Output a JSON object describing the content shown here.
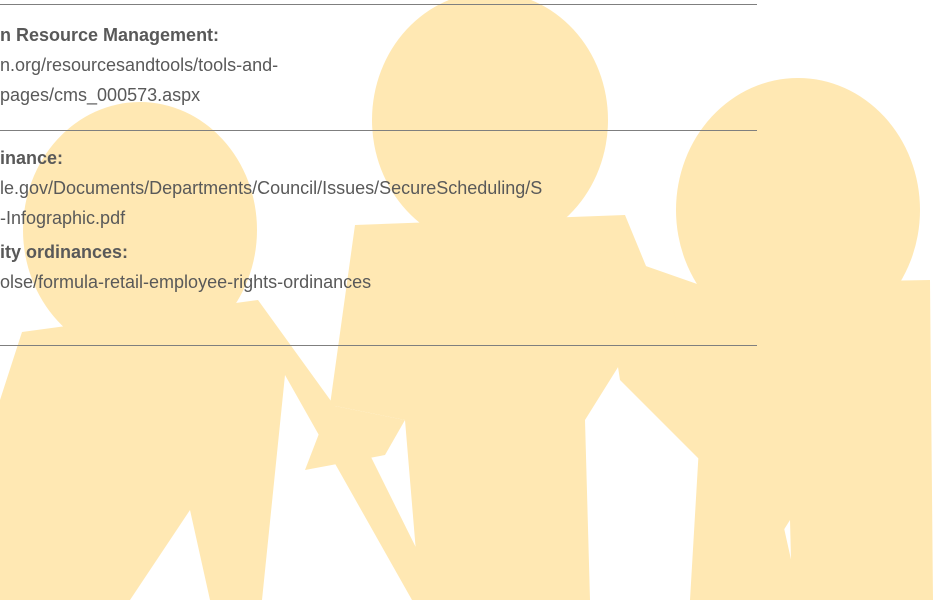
{
  "background": {
    "figure_color": "#FFE8B3",
    "figure_icon": "paper-doll-people-chain"
  },
  "entries": [
    {
      "heading": "n Resource Management:",
      "link_lines": [
        "n.org/resourcesandtools/tools-and-",
        "pages/cms_000573.aspx"
      ]
    },
    {
      "heading": "inance:",
      "link_lines": [
        "le.gov/Documents/Departments/Council/Issues/SecureScheduling/S",
        "-Infographic.pdf"
      ]
    },
    {
      "heading": "ity ordinances:",
      "link_lines": [
        "olse/formula-retail-employee-rights-ordinances"
      ]
    }
  ]
}
